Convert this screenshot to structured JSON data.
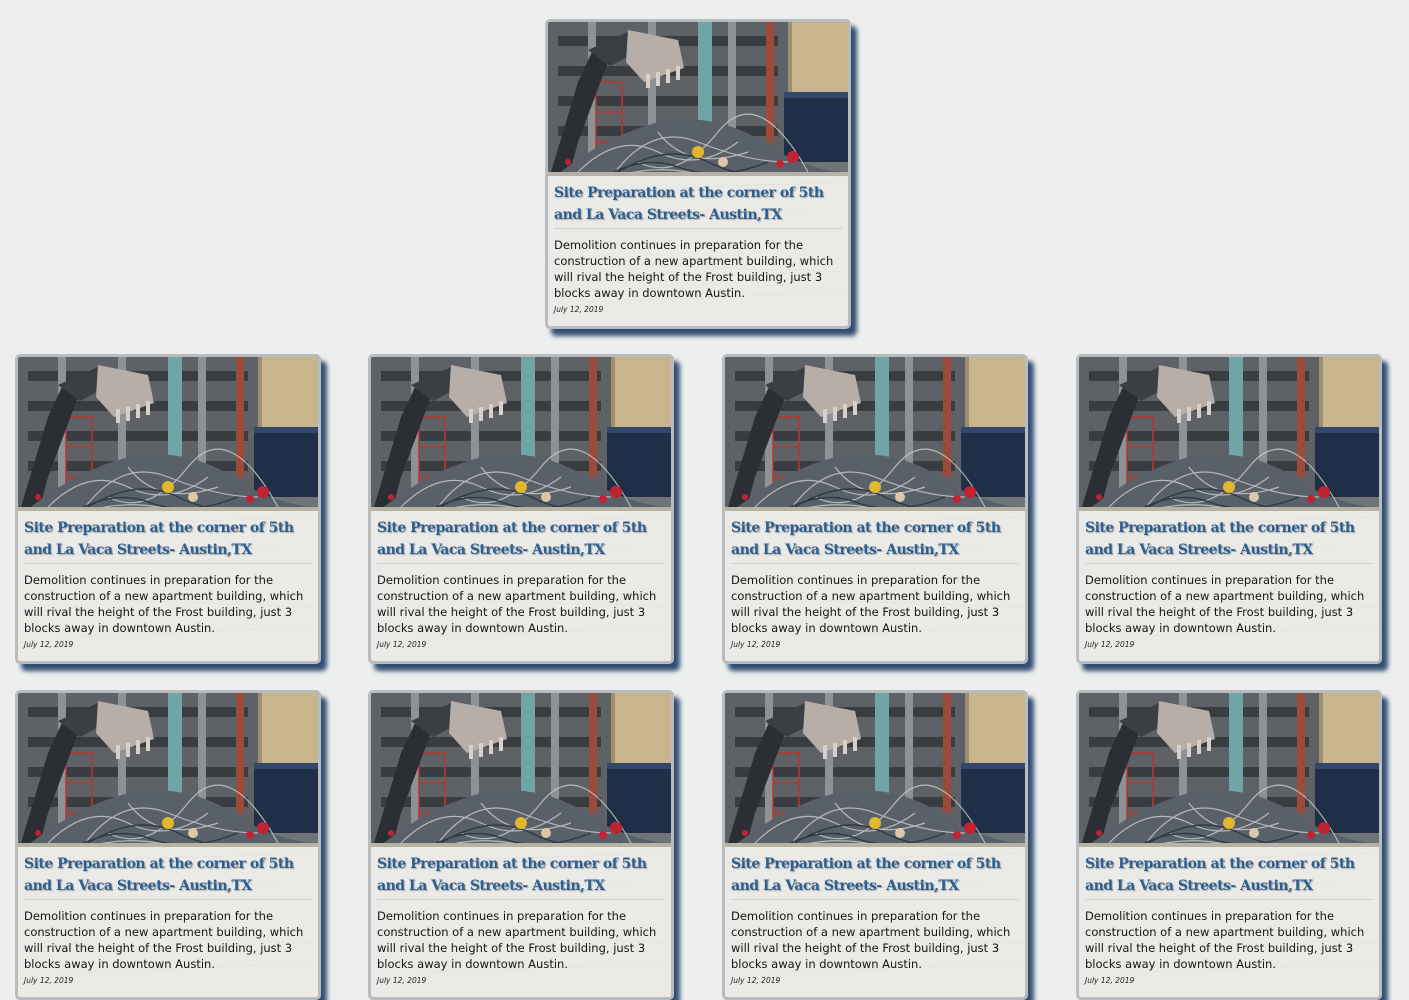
{
  "cards": [
    {
      "title": "Site Preparation at the corner of 5th and La Vaca Streets- Austin,TX",
      "description": "Demolition continues in preparation for the construction of a new apartment building, which will rival the height of the Frost building, just 3 blocks away in downtown Austin.",
      "date": "July 12, 2019",
      "image": "demolition-site-photo"
    },
    {
      "title": "Site Preparation at the corner of 5th and La Vaca Streets- Austin,TX",
      "description": "Demolition continues in preparation for the construction of a new apartment building, which will rival the height of the Frost building, just 3 blocks away in downtown Austin.",
      "date": "July 12, 2019",
      "image": "demolition-site-photo"
    },
    {
      "title": "Site Preparation at the corner of 5th and La Vaca Streets- Austin,TX",
      "description": "Demolition continues in preparation for the construction of a new apartment building, which will rival the height of the Frost building, just 3 blocks away in downtown Austin.",
      "date": "July 12, 2019",
      "image": "demolition-site-photo"
    },
    {
      "title": "Site Preparation at the corner of 5th and La Vaca Streets- Austin,TX",
      "description": "Demolition continues in preparation for the construction of a new apartment building, which will rival the height of the Frost building, just 3 blocks away in downtown Austin.",
      "date": "July 12, 2019",
      "image": "demolition-site-photo"
    },
    {
      "title": "Site Preparation at the corner of 5th and La Vaca Streets- Austin,TX",
      "description": "Demolition continues in preparation for the construction of a new apartment building, which will rival the height of the Frost building, just 3 blocks away in downtown Austin.",
      "date": "July 12, 2019",
      "image": "demolition-site-photo"
    },
    {
      "title": "Site Preparation at the corner of 5th and La Vaca Streets- Austin,TX",
      "description": "Demolition continues in preparation for the construction of a new apartment building, which will rival the height of the Frost building, just 3 blocks away in downtown Austin.",
      "date": "July 12, 2019",
      "image": "demolition-site-photo"
    },
    {
      "title": "Site Preparation at the corner of 5th and La Vaca Streets- Austin,TX",
      "description": "Demolition continues in preparation for the construction of a new apartment building, which will rival the height of the Frost building, just 3 blocks away in downtown Austin.",
      "date": "July 12, 2019",
      "image": "demolition-site-photo"
    },
    {
      "title": "Site Preparation at the corner of 5th and La Vaca Streets- Austin,TX",
      "description": "Demolition continues in preparation for the construction of a new apartment building, which will rival the height of the Frost building, just 3 blocks away in downtown Austin.",
      "date": "July 12, 2019",
      "image": "demolition-site-photo"
    },
    {
      "title": "Site Preparation at the corner of 5th and La Vaca Streets- Austin,TX",
      "description": "Demolition continues in preparation for the construction of a new apartment building, which will rival the height of the Frost building, just 3 blocks away in downtown Austin.",
      "date": "July 12, 2019",
      "image": "demolition-site-photo"
    }
  ],
  "colors": {
    "background": "#edefef",
    "card_border": "#b9bcbf",
    "card_shadow": "#324f73",
    "title": "#2e5f91",
    "text": "#141414"
  }
}
